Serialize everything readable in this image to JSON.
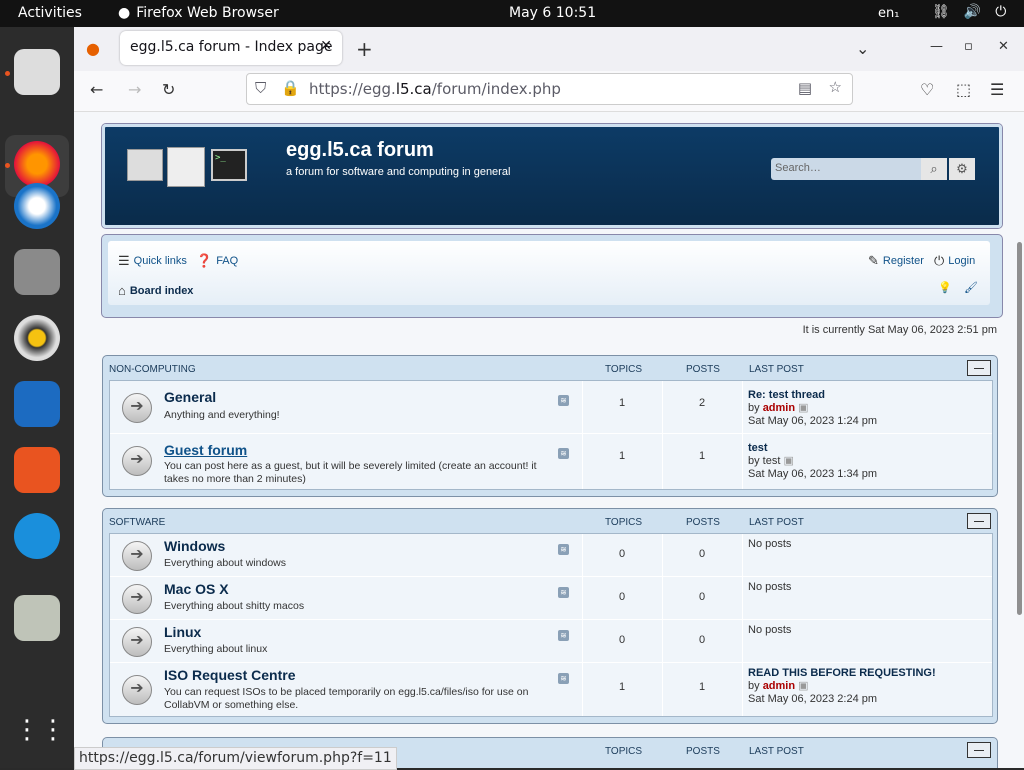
{
  "topbar": {
    "activities": "Activities",
    "app_name": "Firefox Web Browser",
    "clock": "May 6  10:51",
    "lang": "en₁"
  },
  "browser": {
    "tab_title": "egg.l5.ca forum - Index page",
    "url_prefix": "https://egg.",
    "url_domain": "l5.ca",
    "url_path": "/forum/index.php",
    "status_url": "https://egg.l5.ca/forum/viewforum.php?f=11"
  },
  "site": {
    "title": "egg.l5.ca forum",
    "description": "a forum for software and computing in general",
    "search_placeholder": "Search…"
  },
  "nav": {
    "quick_links": "Quick links",
    "faq": "FAQ",
    "register": "Register",
    "login": "Login",
    "board_index": "Board index"
  },
  "time_info": "It is currently Sat May 06, 2023 2:51 pm",
  "columns": {
    "topics": "TOPICS",
    "posts": "POSTS",
    "last_post": "LAST POST"
  },
  "categories": [
    {
      "name": "NON-COMPUTING",
      "forums": [
        {
          "name": "General",
          "desc": "Anything and everything!",
          "topics": "1",
          "posts": "2",
          "lp_title": "Re: test thread",
          "lp_by": "by",
          "lp_author": "admin",
          "lp_date": "Sat May 06, 2023 1:24 pm"
        },
        {
          "name": "Guest forum",
          "desc": "You can post here as a guest, but it will be severely limited (create an account! it takes no more than 2 minutes)",
          "topics": "1",
          "posts": "1",
          "lp_title": "test",
          "lp_by": "by test",
          "lp_date": "Sat May 06, 2023 1:34 pm"
        }
      ]
    },
    {
      "name": "SOFTWARE",
      "forums": [
        {
          "name": "Windows",
          "desc": "Everything about windows",
          "topics": "0",
          "posts": "0",
          "lp_none": "No posts"
        },
        {
          "name": "Mac OS X",
          "desc": "Everything about shitty macos",
          "topics": "0",
          "posts": "0",
          "lp_none": "No posts"
        },
        {
          "name": "Linux",
          "desc": "Everything about linux",
          "topics": "0",
          "posts": "0",
          "lp_none": "No posts"
        },
        {
          "name": "ISO Request Centre",
          "desc": "You can request ISOs to be placed temporarily on egg.l5.ca/files/iso for use on CollabVM or something else.",
          "topics": "1",
          "posts": "1",
          "lp_title": "READ THIS BEFORE REQUESTING!",
          "lp_by": "by",
          "lp_author": "admin",
          "lp_date": "Sat May 06, 2023 2:24 pm"
        }
      ]
    }
  ],
  "colors": {
    "header_bg": "#0d3b66",
    "panel_bg": "#cfe1f0",
    "author": "#aa0000"
  }
}
